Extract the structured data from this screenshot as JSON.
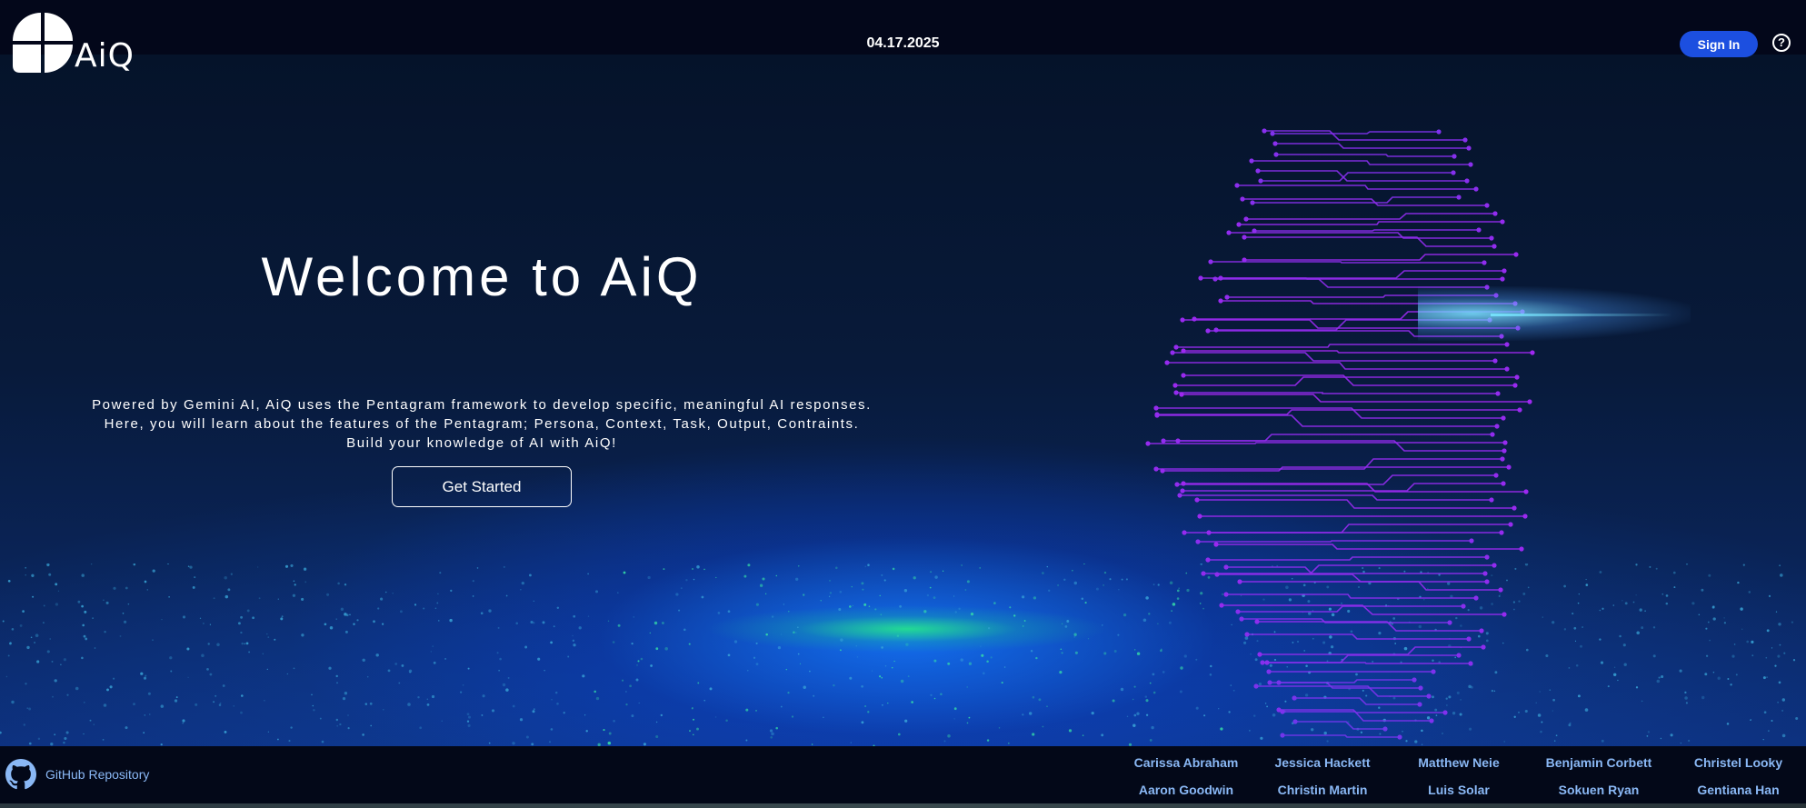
{
  "header": {
    "logo_text": "AiQ",
    "date": "04.17.2025",
    "sign_in_label": "Sign In",
    "help_glyph": "?"
  },
  "hero": {
    "title": "Welcome to AiQ",
    "description_lines": [
      "Powered by Gemini AI, AiQ uses the Pentagram framework to develop specific, meaningful AI responses.",
      "Here, you will learn about the features of the Pentagram; Persona, Context, Task, Output, Contraints.",
      "Build your knowledge of AI with AiQ!"
    ],
    "cta_label": "Get Started"
  },
  "footer": {
    "github_label": "GitHub Repository",
    "contributors": [
      "Carissa Abraham",
      "Jessica Hackett",
      "Matthew Neie",
      "Benjamin Corbett",
      "Christel Looky",
      "Aaron Goodwin",
      "Christin Martin",
      "Luis Solar",
      "Sokuen Ryan",
      "Gentiana Han"
    ]
  },
  "colors": {
    "accent": "#1c4fe0",
    "link": "#8ab8f5",
    "circuit": "#8a3cf0",
    "background": "#050a1a"
  },
  "icons": {
    "logo": "four-quadrant-logo-icon",
    "help": "question-circle-icon",
    "github": "github-octocat-icon"
  }
}
